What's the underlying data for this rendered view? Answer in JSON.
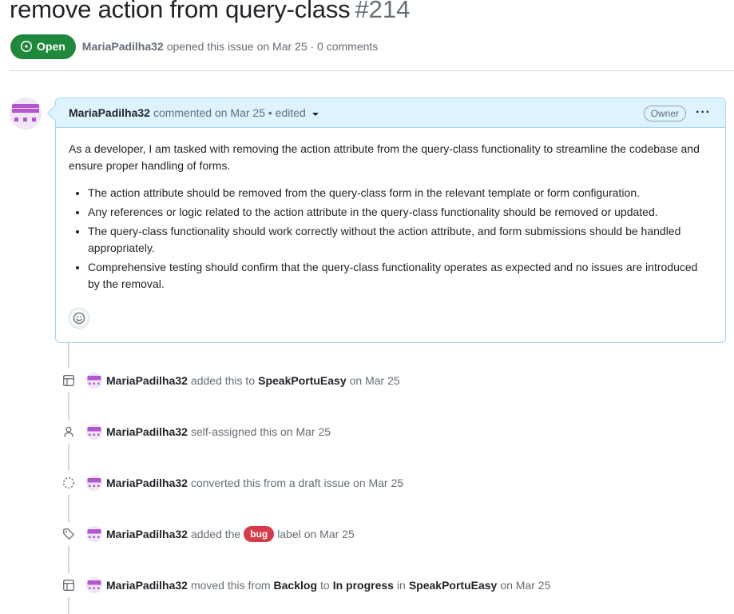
{
  "issue": {
    "title": "remove action from query-class",
    "number": "#214",
    "state": "Open",
    "author": "MariaPadilha32",
    "opened_text": "opened this issue on Mar 25 · 0 comments"
  },
  "comment": {
    "author": "MariaPadilha32",
    "meta": "commented on Mar 25 • edited",
    "badge": "Owner",
    "menu": "···",
    "intro": "As a developer, I am tasked with removing the action attribute from the query-class functionality to streamline the codebase and ensure proper handling of forms.",
    "bullets": [
      "The action attribute should be removed from the query-class form in the relevant template or form configuration.",
      "Any references or logic related to the action attribute in the query-class functionality should be removed or updated.",
      "The query-class functionality should work correctly without the action attribute, and form submissions should be handled appropriately.",
      "Comprehensive testing should confirm that the query-class functionality operates as expected and no issues are introduced by the removal."
    ]
  },
  "events": [
    {
      "icon": "project-table-icon",
      "author": "MariaPadilha32",
      "t1": "added this to",
      "s1": "SpeakPortuEasy",
      "t2": "on Mar 25"
    },
    {
      "icon": "person-icon",
      "author": "MariaPadilha32",
      "t1": "self-assigned this on Mar 25"
    },
    {
      "icon": "draft-issue-icon",
      "author": "MariaPadilha32",
      "t1": "converted this from a draft issue on Mar 25"
    },
    {
      "icon": "tag-icon",
      "author": "MariaPadilha32",
      "t1": "added the",
      "label": "bug",
      "t2": "label on Mar 25"
    },
    {
      "icon": "project-table-icon",
      "author": "MariaPadilha32",
      "t1": "moved this from",
      "s1": "Backlog",
      "t2": "to",
      "s2": "In progress",
      "t3": "in",
      "s3": "SpeakPortuEasy",
      "t4": "on Mar 25"
    }
  ],
  "colors": {
    "open_green": "#1f883d",
    "header_blue": "#ddf4ff",
    "bug_red": "#d73a4a",
    "avatar_purple": "#b255cf"
  }
}
